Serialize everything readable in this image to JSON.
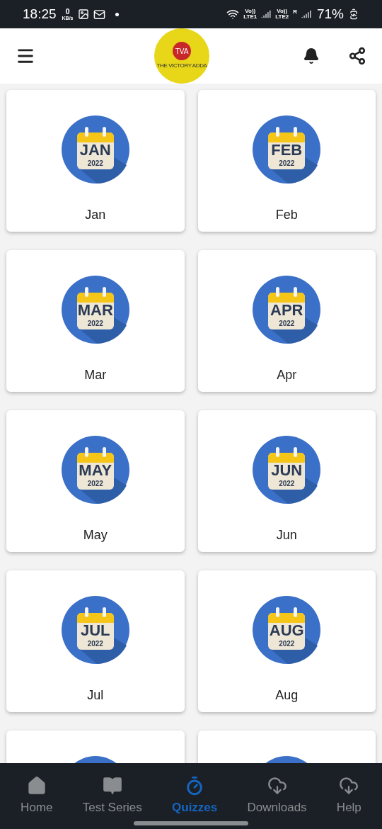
{
  "status_bar": {
    "time": "18:25",
    "speed_value": "0",
    "speed_unit": "KB/s",
    "sim1_volte": "Vo))",
    "sim1_net": "LTE1",
    "sim2_volte": "Vo))",
    "sim2_net": "LTE2",
    "sim2_roaming": "R",
    "battery": "71%"
  },
  "header": {
    "logo_initials": "TVA",
    "logo_name": "THE VICTORY ADDA"
  },
  "months": [
    {
      "label": "Jan",
      "icon_month": "JAN",
      "icon_year": "2022"
    },
    {
      "label": "Feb",
      "icon_month": "FEB",
      "icon_year": "2022"
    },
    {
      "label": "Mar",
      "icon_month": "MAR",
      "icon_year": "2022"
    },
    {
      "label": "Apr",
      "icon_month": "APR",
      "icon_year": "2022"
    },
    {
      "label": "May",
      "icon_month": "MAY",
      "icon_year": "2022"
    },
    {
      "label": "Jun",
      "icon_month": "JUN",
      "icon_year": "2022"
    },
    {
      "label": "Jul",
      "icon_month": "JUL",
      "icon_year": "2022"
    },
    {
      "label": "Aug",
      "icon_month": "AUG",
      "icon_year": "2022"
    }
  ],
  "more_cards": [
    {
      "kind": "partial"
    },
    {
      "kind": "partial"
    }
  ],
  "bottom_nav": [
    {
      "kind": "home",
      "label": "Home",
      "selected": false
    },
    {
      "kind": "book",
      "label": "Test Series",
      "selected": false
    },
    {
      "kind": "timer",
      "label": "Quizzes",
      "selected": true
    },
    {
      "kind": "cloud",
      "label": "Downloads",
      "selected": false
    },
    {
      "kind": "cloud",
      "label": "Help",
      "selected": false
    }
  ]
}
